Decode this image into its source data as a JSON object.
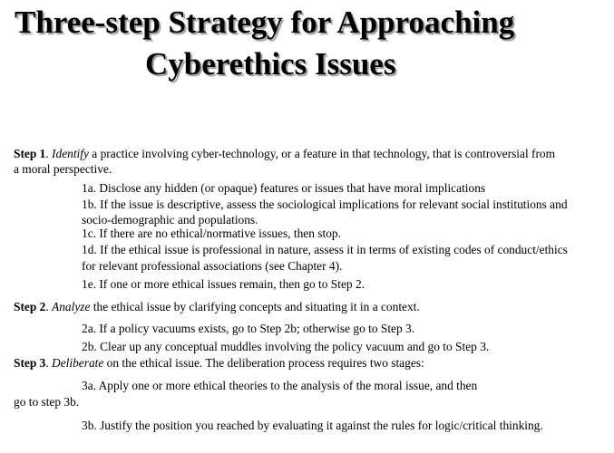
{
  "title": {
    "line1": "Three-step Strategy for Approaching",
    "line2": "Cyberethics Issues"
  },
  "step1": {
    "label": "Step 1",
    "verb": "Identify",
    "text": " a practice involving cyber-technology, or a feature in that technology, that is controversial from",
    "text2": "a moral perspective.",
    "items": {
      "a": "1a. Disclose any hidden (or opaque) features or issues that have moral implications",
      "b1": "1b. If the issue is descriptive, assess the sociological implications for relevant social institutions and",
      "b2": "socio-demographic and populations.",
      "c": "1c. If there are no ethical/normative issues, then stop.",
      "d1": "1d. If the ethical issue is professional in nature, assess it in terms of existing codes of conduct/ethics",
      "d2": "for relevant professional associations (see Chapter 4).",
      "e": "1e. If one or more ethical issues remain, then go to Step 2."
    }
  },
  "step2": {
    "label": "Step 2",
    "verb": "Analyze",
    "text": " the ethical issue by clarifying concepts and situating it in a context.",
    "items": {
      "a": "2a. If a policy vacuums exists, go to Step 2b; otherwise go to Step 3.",
      "b": "2b. Clear up any conceptual muddles involving the policy vacuum and go to Step 3."
    }
  },
  "step3": {
    "label": "Step 3",
    "verb": "Deliberate",
    "text": " on the ethical issue. The deliberation process requires two stages:",
    "items": {
      "a1": "3a.  Apply one or more ethical theories to the analysis of the moral issue, and then",
      "a2": "go to step 3b.",
      "b": "3b. Justify the position you reached by evaluating it against the rules for logic/critical thinking."
    }
  },
  "punct": {
    "dot": ". "
  }
}
